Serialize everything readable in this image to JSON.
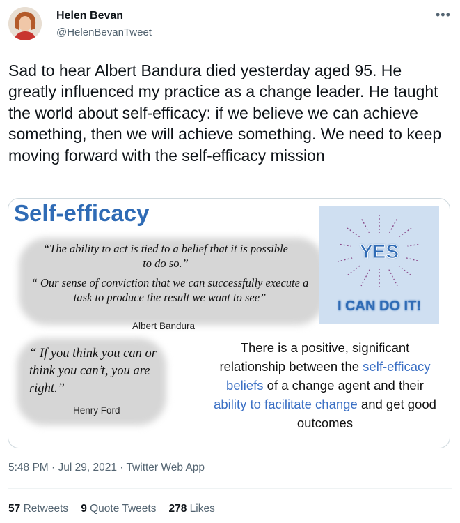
{
  "author": {
    "name": "Helen Bevan",
    "handle": "@HelenBevanTweet"
  },
  "more_icon": "more-dots-icon",
  "text": "Sad to hear Albert Bandura died yesterday aged 95. He greatly influenced my practice as a change leader. He taught the world about self-efficacy: if we believe we can achieve something, then we will achieve something. We need to keep moving forward with the self-efficacy mission",
  "media": {
    "title": "Self-efficacy",
    "quote1": "“The ability to act is tied to a belief that it is possible to do so.”",
    "quote2": "“ Our sense of conviction that we can successfully execute a task to produce the result we want to see”",
    "quote_author": "Albert Bandura",
    "ford_quote": "“ If you think you can or think you can’t, you are right.”",
    "ford_author": "Henry Ford",
    "yes": "YES",
    "can_do": "I CAN DO IT!",
    "statement_a": "There is a positive, significant relationship between the ",
    "statement_b": "self-efficacy beliefs",
    "statement_c": " of  a change agent and their ",
    "statement_d": "ability to facilitate change",
    "statement_e": " and get good outcomes"
  },
  "timestamp": "5:48 PM · Jul 29, 2021 · Twitter Web App",
  "stats": {
    "retweets_count": "57",
    "retweets_label": "Retweets",
    "quotes_count": "9",
    "quotes_label": "Quote Tweets",
    "likes_count": "278",
    "likes_label": "Likes"
  },
  "colors": {
    "accent": "#2f6bb5",
    "muted": "#536471"
  }
}
